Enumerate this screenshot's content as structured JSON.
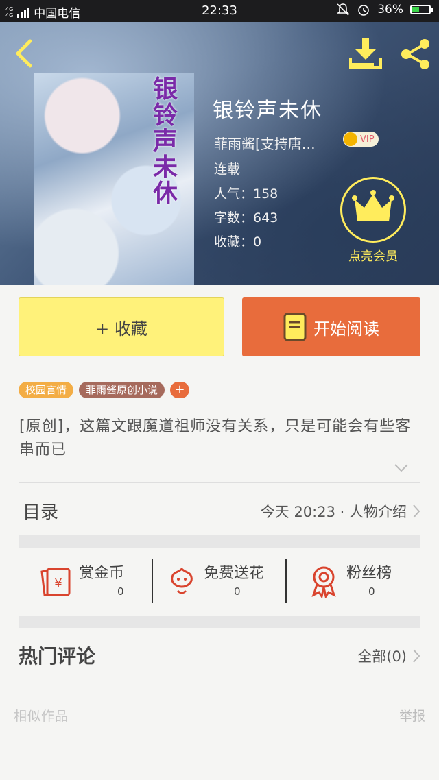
{
  "status_bar": {
    "carrier": "中国电信",
    "signal_label_1": "4G",
    "signal_label_2": "4G",
    "time": "22:33",
    "battery": "36%"
  },
  "book": {
    "cover_title": "银铃声未休",
    "title": "银铃声未休",
    "author": "菲雨酱[支持唐…",
    "vip_label": "VIP",
    "status": "连载",
    "popularity": "人气：158",
    "word_count": "字数：643",
    "favorites": "收藏：0"
  },
  "member": {
    "label": "点亮会员"
  },
  "buttons": {
    "collect": "+ 收藏",
    "read": "开始阅读"
  },
  "tags": [
    "校园言情",
    "菲雨酱原创小说",
    "+"
  ],
  "description": "[原创]，这篇文跟魔道祖师没有关系，只是可能会有些客串而已",
  "catalog": {
    "label": "目录",
    "latest": "今天 20:23 · 人物介绍"
  },
  "actions": [
    {
      "label": "赏金币",
      "count": "0"
    },
    {
      "label": "免费送花",
      "count": "0"
    },
    {
      "label": "粉丝榜",
      "count": "0"
    }
  ],
  "comments": {
    "label": "热门评论",
    "all": "全部(0)"
  },
  "footer": {
    "similar": "相似作品",
    "report": "举报"
  },
  "colors": {
    "accent_orange": "#e86c3c",
    "collect_yellow": "#fff27a",
    "icon_yellow": "#ffec5c",
    "icon_red": "#d9442e"
  }
}
